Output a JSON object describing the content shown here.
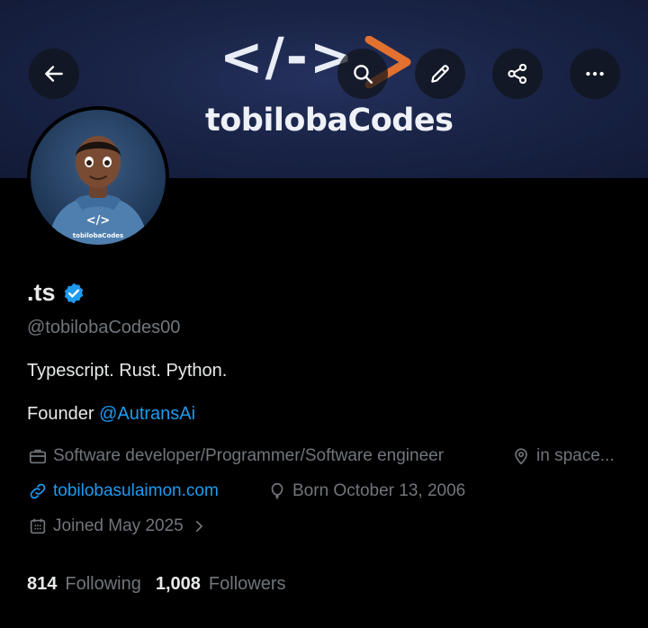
{
  "banner": {
    "logo_code": "</->",
    "logo_text": "tobilobaCodes"
  },
  "header": {
    "back_icon": "arrow-left-icon",
    "search_icon": "search-icon",
    "edit_icon": "pencil-icon",
    "share_icon": "share-icon",
    "more_icon": "more-horizontal-icon"
  },
  "avatar": {
    "hoodie_logo": "</>",
    "hoodie_text": "tobilobaCodes"
  },
  "profile": {
    "display_name": ".ts",
    "handle": "@tobilobaCodes00",
    "bio_line1": "Typescript. Rust. Python.",
    "bio_line2_prefix": "Founder ",
    "bio_line2_mention": "@AutransAi",
    "profession": "Software developer/Programmer/Software engineer",
    "location": "in space...",
    "website": "tobilobasulaimon.com",
    "birthday": "Born October 13, 2006",
    "joined": "Joined May 2025"
  },
  "stats": {
    "following_count": "814",
    "following_label": "Following",
    "followers_count": "1,008",
    "followers_label": "Followers"
  },
  "colors": {
    "accent": "#1d9bf0",
    "muted": "#71767b",
    "text": "#e7e9ea",
    "logo_orange": "#e2712f",
    "banner": "#1a2447"
  }
}
